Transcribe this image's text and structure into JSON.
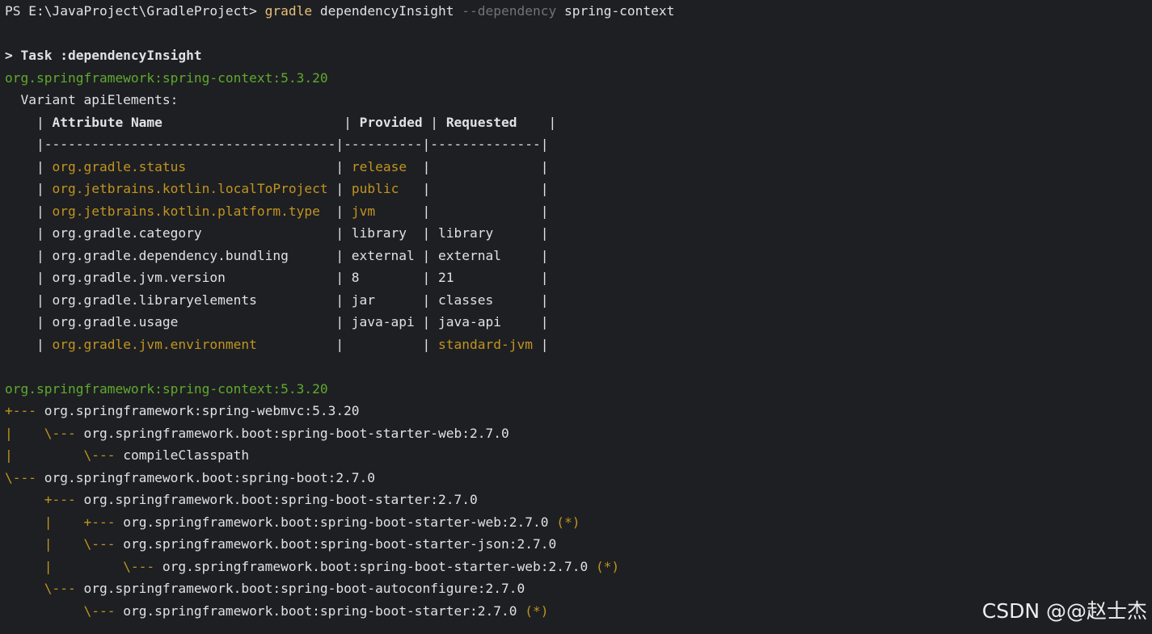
{
  "terminal": {
    "colors": {
      "background": "#1e1f22",
      "default": "#dfe1e5",
      "command": "#e5c07b",
      "flag": "#6f737a",
      "green": "#5faa2e",
      "yellow": "#c09420"
    },
    "lines": [
      [
        {
          "t": "PS E:\\JavaProject\\GradleProject> ",
          "c": "default"
        },
        {
          "t": "gradle",
          "c": "cmd"
        },
        {
          "t": " dependencyInsight ",
          "c": "default"
        },
        {
          "t": "--dependency",
          "c": "flag"
        },
        {
          "t": " spring-context",
          "c": "default"
        }
      ],
      [],
      [
        {
          "t": "> Task :dependencyInsight",
          "c": "bold"
        }
      ],
      [
        {
          "t": "org.springframework:spring-context:5.3.20",
          "c": "green"
        }
      ],
      [
        {
          "t": "  Variant apiElements:",
          "c": "default"
        }
      ],
      [
        {
          "t": "    | ",
          "c": "default"
        },
        {
          "t": "Attribute Name",
          "c": "bold"
        },
        {
          "t": "                       | ",
          "c": "default"
        },
        {
          "t": "Provided",
          "c": "bold"
        },
        {
          "t": " | ",
          "c": "default"
        },
        {
          "t": "Requested",
          "c": "bold"
        },
        {
          "t": "    |",
          "c": "default"
        }
      ],
      [
        {
          "t": "    |-------------------------------------|----------|--------------|",
          "c": "default"
        }
      ],
      [
        {
          "t": "    | ",
          "c": "default"
        },
        {
          "t": "org.gradle.status",
          "c": "yellow"
        },
        {
          "t": "                   | ",
          "c": "default"
        },
        {
          "t": "release",
          "c": "yellow"
        },
        {
          "t": "  |              |",
          "c": "default"
        }
      ],
      [
        {
          "t": "    | ",
          "c": "default"
        },
        {
          "t": "org.jetbrains.kotlin.localToProject",
          "c": "yellow"
        },
        {
          "t": " | ",
          "c": "default"
        },
        {
          "t": "public",
          "c": "yellow"
        },
        {
          "t": "   |              |",
          "c": "default"
        }
      ],
      [
        {
          "t": "    | ",
          "c": "default"
        },
        {
          "t": "org.jetbrains.kotlin.platform.type",
          "c": "yellow"
        },
        {
          "t": "  | ",
          "c": "default"
        },
        {
          "t": "jvm",
          "c": "yellow"
        },
        {
          "t": "      |              |",
          "c": "default"
        }
      ],
      [
        {
          "t": "    | org.gradle.category                 | library  | library      |",
          "c": "default"
        }
      ],
      [
        {
          "t": "    | org.gradle.dependency.bundling      | external | external     |",
          "c": "default"
        }
      ],
      [
        {
          "t": "    | org.gradle.jvm.version              | 8        | 21           |",
          "c": "default"
        }
      ],
      [
        {
          "t": "    | org.gradle.libraryelements          | jar      | classes      |",
          "c": "default"
        }
      ],
      [
        {
          "t": "    | org.gradle.usage                    | java-api | java-api     |",
          "c": "default"
        }
      ],
      [
        {
          "t": "    | ",
          "c": "default"
        },
        {
          "t": "org.gradle.jvm.environment",
          "c": "yellow"
        },
        {
          "t": "          |          | ",
          "c": "default"
        },
        {
          "t": "standard-jvm",
          "c": "yellow"
        },
        {
          "t": " |",
          "c": "default"
        }
      ],
      [],
      [
        {
          "t": "org.springframework:spring-context:5.3.20",
          "c": "green"
        }
      ],
      [
        {
          "t": "+---",
          "c": "yellow"
        },
        {
          "t": " org.springframework:spring-webmvc:5.3.20",
          "c": "default"
        }
      ],
      [
        {
          "t": "|    \\---",
          "c": "yellow"
        },
        {
          "t": " org.springframework.boot:spring-boot-starter-web:2.7.0",
          "c": "default"
        }
      ],
      [
        {
          "t": "|         \\---",
          "c": "yellow"
        },
        {
          "t": " compileClasspath",
          "c": "default"
        }
      ],
      [
        {
          "t": "\\---",
          "c": "yellow"
        },
        {
          "t": " org.springframework.boot:spring-boot:2.7.0",
          "c": "default"
        }
      ],
      [
        {
          "t": "     +---",
          "c": "yellow"
        },
        {
          "t": " org.springframework.boot:spring-boot-starter:2.7.0",
          "c": "default"
        }
      ],
      [
        {
          "t": "     |    +---",
          "c": "yellow"
        },
        {
          "t": " org.springframework.boot:spring-boot-starter-web:2.7.0 ",
          "c": "default"
        },
        {
          "t": "(*)",
          "c": "yellow"
        }
      ],
      [
        {
          "t": "     |    \\---",
          "c": "yellow"
        },
        {
          "t": " org.springframework.boot:spring-boot-starter-json:2.7.0",
          "c": "default"
        }
      ],
      [
        {
          "t": "     |         \\---",
          "c": "yellow"
        },
        {
          "t": " org.springframework.boot:spring-boot-starter-web:2.7.0 ",
          "c": "default"
        },
        {
          "t": "(*)",
          "c": "yellow"
        }
      ],
      [
        {
          "t": "     \\---",
          "c": "yellow"
        },
        {
          "t": " org.springframework.boot:spring-boot-autoconfigure:2.7.0",
          "c": "default"
        }
      ],
      [
        {
          "t": "          \\---",
          "c": "yellow"
        },
        {
          "t": " org.springframework.boot:spring-boot-starter:2.7.0 ",
          "c": "default"
        },
        {
          "t": "(*)",
          "c": "yellow"
        }
      ]
    ]
  },
  "watermark": {
    "text": "CSDN @@赵士杰"
  }
}
